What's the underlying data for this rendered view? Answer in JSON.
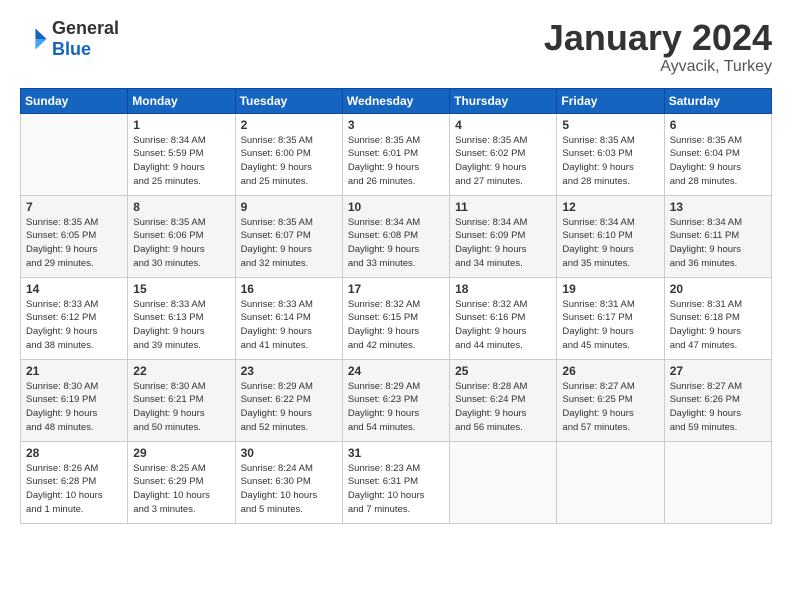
{
  "header": {
    "logo_general": "General",
    "logo_blue": "Blue",
    "month": "January 2024",
    "location": "Ayvacik, Turkey"
  },
  "days_of_week": [
    "Sunday",
    "Monday",
    "Tuesday",
    "Wednesday",
    "Thursday",
    "Friday",
    "Saturday"
  ],
  "weeks": [
    [
      {
        "num": "",
        "info": ""
      },
      {
        "num": "1",
        "info": "Sunrise: 8:34 AM\nSunset: 5:59 PM\nDaylight: 9 hours\nand 25 minutes."
      },
      {
        "num": "2",
        "info": "Sunrise: 8:35 AM\nSunset: 6:00 PM\nDaylight: 9 hours\nand 25 minutes."
      },
      {
        "num": "3",
        "info": "Sunrise: 8:35 AM\nSunset: 6:01 PM\nDaylight: 9 hours\nand 26 minutes."
      },
      {
        "num": "4",
        "info": "Sunrise: 8:35 AM\nSunset: 6:02 PM\nDaylight: 9 hours\nand 27 minutes."
      },
      {
        "num": "5",
        "info": "Sunrise: 8:35 AM\nSunset: 6:03 PM\nDaylight: 9 hours\nand 28 minutes."
      },
      {
        "num": "6",
        "info": "Sunrise: 8:35 AM\nSunset: 6:04 PM\nDaylight: 9 hours\nand 28 minutes."
      }
    ],
    [
      {
        "num": "7",
        "info": "Sunrise: 8:35 AM\nSunset: 6:05 PM\nDaylight: 9 hours\nand 29 minutes."
      },
      {
        "num": "8",
        "info": "Sunrise: 8:35 AM\nSunset: 6:06 PM\nDaylight: 9 hours\nand 30 minutes."
      },
      {
        "num": "9",
        "info": "Sunrise: 8:35 AM\nSunset: 6:07 PM\nDaylight: 9 hours\nand 32 minutes."
      },
      {
        "num": "10",
        "info": "Sunrise: 8:34 AM\nSunset: 6:08 PM\nDaylight: 9 hours\nand 33 minutes."
      },
      {
        "num": "11",
        "info": "Sunrise: 8:34 AM\nSunset: 6:09 PM\nDaylight: 9 hours\nand 34 minutes."
      },
      {
        "num": "12",
        "info": "Sunrise: 8:34 AM\nSunset: 6:10 PM\nDaylight: 9 hours\nand 35 minutes."
      },
      {
        "num": "13",
        "info": "Sunrise: 8:34 AM\nSunset: 6:11 PM\nDaylight: 9 hours\nand 36 minutes."
      }
    ],
    [
      {
        "num": "14",
        "info": "Sunrise: 8:33 AM\nSunset: 6:12 PM\nDaylight: 9 hours\nand 38 minutes."
      },
      {
        "num": "15",
        "info": "Sunrise: 8:33 AM\nSunset: 6:13 PM\nDaylight: 9 hours\nand 39 minutes."
      },
      {
        "num": "16",
        "info": "Sunrise: 8:33 AM\nSunset: 6:14 PM\nDaylight: 9 hours\nand 41 minutes."
      },
      {
        "num": "17",
        "info": "Sunrise: 8:32 AM\nSunset: 6:15 PM\nDaylight: 9 hours\nand 42 minutes."
      },
      {
        "num": "18",
        "info": "Sunrise: 8:32 AM\nSunset: 6:16 PM\nDaylight: 9 hours\nand 44 minutes."
      },
      {
        "num": "19",
        "info": "Sunrise: 8:31 AM\nSunset: 6:17 PM\nDaylight: 9 hours\nand 45 minutes."
      },
      {
        "num": "20",
        "info": "Sunrise: 8:31 AM\nSunset: 6:18 PM\nDaylight: 9 hours\nand 47 minutes."
      }
    ],
    [
      {
        "num": "21",
        "info": "Sunrise: 8:30 AM\nSunset: 6:19 PM\nDaylight: 9 hours\nand 48 minutes."
      },
      {
        "num": "22",
        "info": "Sunrise: 8:30 AM\nSunset: 6:21 PM\nDaylight: 9 hours\nand 50 minutes."
      },
      {
        "num": "23",
        "info": "Sunrise: 8:29 AM\nSunset: 6:22 PM\nDaylight: 9 hours\nand 52 minutes."
      },
      {
        "num": "24",
        "info": "Sunrise: 8:29 AM\nSunset: 6:23 PM\nDaylight: 9 hours\nand 54 minutes."
      },
      {
        "num": "25",
        "info": "Sunrise: 8:28 AM\nSunset: 6:24 PM\nDaylight: 9 hours\nand 56 minutes."
      },
      {
        "num": "26",
        "info": "Sunrise: 8:27 AM\nSunset: 6:25 PM\nDaylight: 9 hours\nand 57 minutes."
      },
      {
        "num": "27",
        "info": "Sunrise: 8:27 AM\nSunset: 6:26 PM\nDaylight: 9 hours\nand 59 minutes."
      }
    ],
    [
      {
        "num": "28",
        "info": "Sunrise: 8:26 AM\nSunset: 6:28 PM\nDaylight: 10 hours\nand 1 minute."
      },
      {
        "num": "29",
        "info": "Sunrise: 8:25 AM\nSunset: 6:29 PM\nDaylight: 10 hours\nand 3 minutes."
      },
      {
        "num": "30",
        "info": "Sunrise: 8:24 AM\nSunset: 6:30 PM\nDaylight: 10 hours\nand 5 minutes."
      },
      {
        "num": "31",
        "info": "Sunrise: 8:23 AM\nSunset: 6:31 PM\nDaylight: 10 hours\nand 7 minutes."
      },
      {
        "num": "",
        "info": ""
      },
      {
        "num": "",
        "info": ""
      },
      {
        "num": "",
        "info": ""
      }
    ]
  ]
}
